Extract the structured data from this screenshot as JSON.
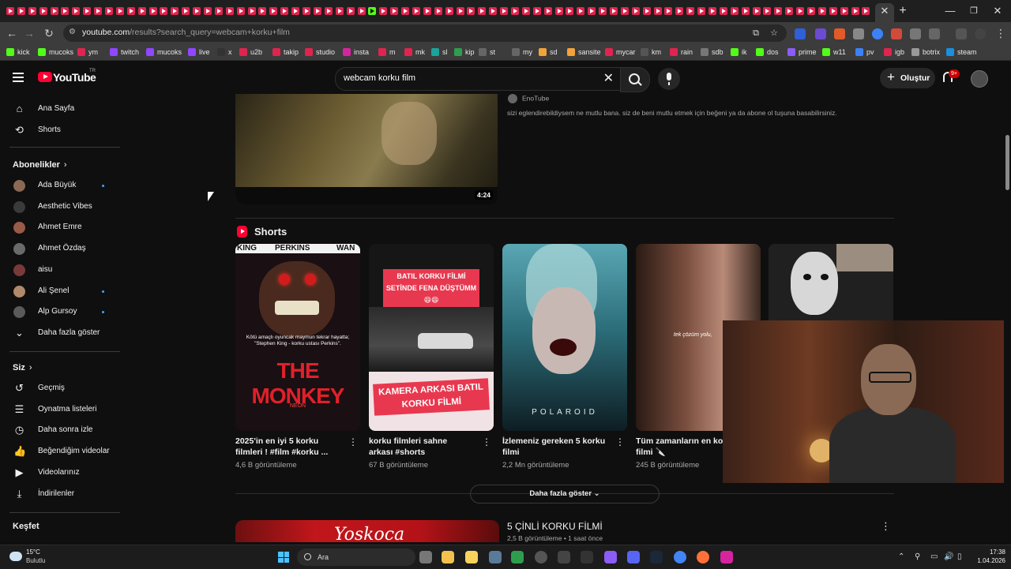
{
  "browser": {
    "url_host": "youtube.com",
    "url_path": "/results?search_query=webcam+korku+film",
    "bookmarks": [
      "kick",
      "mucoks",
      "ym",
      "twitch",
      "mucoks",
      "live",
      "x",
      "u2b",
      "takip",
      "studio",
      "insta",
      "m",
      "mk",
      "sl",
      "kip",
      "st",
      "my",
      "sd",
      "sansite",
      "mycar",
      "km",
      "rain",
      "sdb",
      "ik",
      "dos",
      "prime",
      "w11",
      "pv",
      "igb",
      "botrix",
      "steam"
    ]
  },
  "youtube": {
    "logo_text": "YouTube",
    "logo_tm": "TR",
    "search_query": "webcam korku film",
    "create_label": "Oluştur",
    "notif_badge": "9+"
  },
  "sidebar": {
    "home": "Ana Sayfa",
    "shorts": "Shorts",
    "subscriptions_title": "Abonelikler",
    "subscriptions": [
      {
        "name": "Ada Büyük",
        "dot": true
      },
      {
        "name": "Aesthetic Vibes",
        "dot": false
      },
      {
        "name": "Ahmet Emre",
        "dot": false
      },
      {
        "name": "Ahmet Özdaş",
        "dot": false
      },
      {
        "name": "aisu",
        "dot": false
      },
      {
        "name": "Ali Şenel",
        "dot": true
      },
      {
        "name": "Alp Gursoy",
        "dot": true
      }
    ],
    "show_more": "Daha fazla göster",
    "you_title": "Siz",
    "you_items": [
      "Geçmiş",
      "Oynatma listeleri",
      "Daha sonra izle",
      "Beğendiğim videolar",
      "Videolarınız",
      "İndirilenler"
    ],
    "explore_title": "Keşfet"
  },
  "results": {
    "top_video": {
      "channel": "EnoTube",
      "description": "sizi eglendirebildiysem ne mutlu bana. siz de beni mutlu etmek için beğeni ya da abone ol tuşuna basabilirsiniz.",
      "duration": "4:24"
    },
    "shorts_title": "Shorts",
    "shorts": [
      {
        "title": "2025'in en iyi 5 korku filmleri ! #film  #korku ...",
        "views": "4,6 B görüntüleme"
      },
      {
        "title": "korku filmleri sahne arkası #shorts",
        "views": "67 B görüntüleme"
      },
      {
        "title": "İzlemeniz gereken 5 korku filmi",
        "views": "2,2 Mn görüntüleme"
      },
      {
        "title": "Tüm zamanların en korku filmi 🔪",
        "views": "245 B görüntüleme"
      },
      {
        "title": "",
        "views": ""
      }
    ],
    "short_texts": {
      "s1_top": [
        "KING",
        "PERKINS",
        "WAN"
      ],
      "s1_quote": "Kötü amaçlı oyuncak maymun tekrar hayatta; \"Stephen King - korku ustası Perkins\".",
      "s1_big": "THE MONKEY",
      "s1_neon": "NEON",
      "s2_top": "BATIL KORKU FİLMİ SETİNDE FENA DÜŞTÜMM 😄😄",
      "s2_bottom": "KAMERA ARKASI BATIL KORKU FİLMİ",
      "s3_title": "POLAROID",
      "s4_caption": "tek çözüm yolu,"
    },
    "show_more": "Daha fazla göster",
    "second_video": {
      "title": "5 ÇİNLİ KORKU FİLMİ",
      "meta": "2,5 B görüntüleme • 1 saat önce",
      "thumb_logo": "Yoskoca"
    }
  },
  "taskbar": {
    "temp": "15°C",
    "weather": "Bulutlu",
    "search": "Ara",
    "time": "17:38",
    "date": "1.04.2026"
  },
  "colors": {
    "background": "#0f0f0f",
    "youtube_red": "#ff0033",
    "link_blue": "#3ea6ff"
  }
}
